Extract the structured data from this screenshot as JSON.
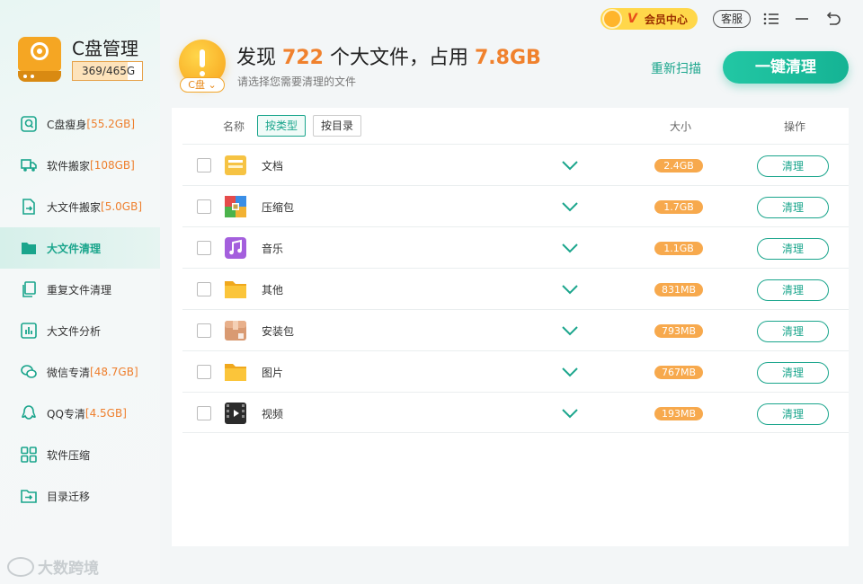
{
  "app": {
    "title": "C盘管理",
    "disk_usage": "369/465G",
    "disk_fill_fraction": 0.79
  },
  "titlebar": {
    "vip_label": "会员中心",
    "vip_letter": "V",
    "service_label": "客服"
  },
  "sidebar": {
    "items": [
      {
        "label": "C盘瘦身",
        "size": "[55.2GB]",
        "icon": "magnifier-icon"
      },
      {
        "label": "软件搬家",
        "size": "[108GB]",
        "icon": "truck-icon"
      },
      {
        "label": "大文件搬家",
        "size": "[5.0GB]",
        "icon": "file-move-icon"
      },
      {
        "label": "大文件清理",
        "size": "",
        "icon": "folder-icon"
      },
      {
        "label": "重复文件清理",
        "size": "",
        "icon": "duplicate-icon"
      },
      {
        "label": "大文件分析",
        "size": "",
        "icon": "chart-icon"
      },
      {
        "label": "微信专清",
        "size": "[48.7GB]",
        "icon": "wechat-icon"
      },
      {
        "label": "QQ专清",
        "size": "[4.5GB]",
        "icon": "qq-icon"
      },
      {
        "label": "软件压缩",
        "size": "",
        "icon": "grid-icon"
      },
      {
        "label": "目录迁移",
        "size": "",
        "icon": "folder-migrate-icon"
      }
    ],
    "watermark": "大数跨境"
  },
  "header": {
    "drive": "C盘",
    "found_prefix": "发现",
    "found_count": "722",
    "found_mid": "个大文件，占用",
    "found_size": "7.8GB",
    "subtitle": "请选择您需要清理的文件",
    "rescan_label": "重新扫描",
    "clean_all_label": "一键清理"
  },
  "table": {
    "col_name": "名称",
    "tab_by_type": "按类型",
    "tab_by_dir": "按目录",
    "col_size": "大小",
    "col_action": "操作",
    "rows": [
      {
        "name": "文档",
        "size": "2.4GB",
        "action": "清理",
        "icon": "document-icon"
      },
      {
        "name": "压缩包",
        "size": "1.7GB",
        "action": "清理",
        "icon": "archive-icon"
      },
      {
        "name": "音乐",
        "size": "1.1GB",
        "action": "清理",
        "icon": "music-icon"
      },
      {
        "name": "其他",
        "size": "831MB",
        "action": "清理",
        "icon": "folder-icon"
      },
      {
        "name": "安装包",
        "size": "793MB",
        "action": "清理",
        "icon": "package-icon"
      },
      {
        "name": "图片",
        "size": "767MB",
        "action": "清理",
        "icon": "folder-icon"
      },
      {
        "name": "视频",
        "size": "193MB",
        "action": "清理",
        "icon": "video-icon"
      }
    ]
  },
  "colors": {
    "accent": "#1aa58c",
    "highlight": "#f0812d",
    "badge": "#f7a94d"
  }
}
